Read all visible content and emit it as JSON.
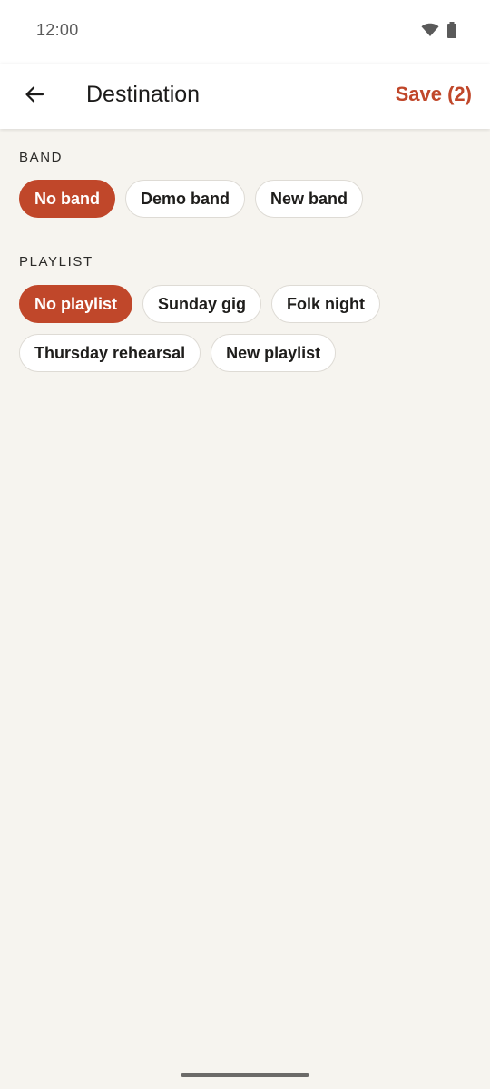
{
  "status_bar": {
    "time": "12:00",
    "icons": [
      "wifi-icon",
      "battery-icon"
    ]
  },
  "app_bar": {
    "back_icon": "arrow-left-icon",
    "title": "Destination",
    "save_label": "Save (2)"
  },
  "band_section": {
    "label": "BAND",
    "chips": [
      {
        "label": "No band",
        "selected": true
      },
      {
        "label": "Demo band",
        "selected": false
      },
      {
        "label": "New band",
        "selected": false
      }
    ]
  },
  "playlist_section": {
    "label": "PLAYLIST",
    "chips": [
      {
        "label": "No playlist",
        "selected": true
      },
      {
        "label": "Sunday gig",
        "selected": false
      },
      {
        "label": "Folk night",
        "selected": false
      },
      {
        "label": "Thursday rehearsal",
        "selected": false
      },
      {
        "label": "New playlist",
        "selected": false
      }
    ]
  },
  "colors": {
    "accent": "#c0472a",
    "background": "#f6f4ef",
    "surface": "#ffffff"
  }
}
